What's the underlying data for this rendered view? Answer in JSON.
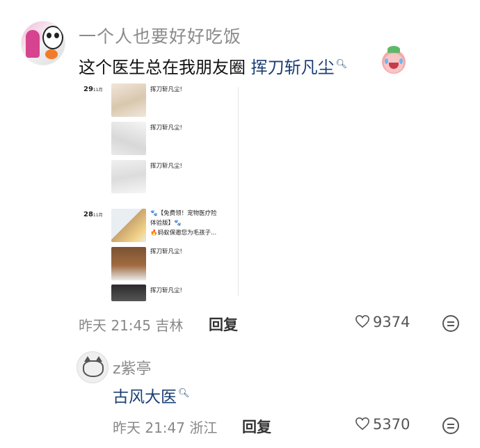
{
  "comment": {
    "username": "一个人也要好好吃饭",
    "text_prefix": "这个医生总在我朋友圈",
    "link_text": "挥刀斩凡尘",
    "search_icon": "search-icon",
    "emoji": "crying-peach-emoji",
    "meta": "昨天 21:45 吉林",
    "reply_label": "回复",
    "likes": "9374"
  },
  "screenshot": {
    "groups": [
      {
        "date_day": "29",
        "date_month": "11月",
        "posts": [
          {
            "caption": "挥刀斩凡尘!"
          },
          {
            "caption": "挥刀斩凡尘!"
          },
          {
            "caption": "挥刀斩凡尘!"
          }
        ]
      },
      {
        "date_day": "28",
        "date_month": "11月",
        "posts": [
          {
            "caption_line1": "🐾【免费领！宠物医疗险",
            "caption_line2": "体验版】🐾",
            "caption_line3": "🔥蚂蚁保邀您为毛孩子..."
          },
          {
            "caption": "挥刀斩凡尘!"
          },
          {
            "caption": "挥刀斩凡尘!"
          }
        ]
      }
    ]
  },
  "reply": {
    "username": "z紫亭",
    "link_text": "古风大医",
    "meta": "昨天 21:47 浙江",
    "reply_label": "回复",
    "likes": "5370"
  }
}
